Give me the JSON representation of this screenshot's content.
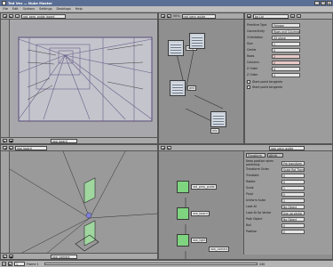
{
  "app": {
    "title": "Ted Vex — Nuke Master",
    "window_buttons": [
      "_",
      "□",
      "×"
    ]
  },
  "menubar": [
    "File",
    "Edit",
    "Options",
    "Settings",
    "Desktops",
    "Help"
  ],
  "pane_tl": {
    "field": "rod_perp_guide_board",
    "bottom_field": "row_board"
  },
  "pane_tr": {
    "zoom": "50%",
    "field": "rod_perp_guide",
    "nodes": [
      {
        "label": "rod_a"
      },
      {
        "label": "rod_b"
      },
      {
        "label": "grid"
      },
      {
        "label": "mix"
      }
    ]
  },
  "pane_tr_props": {
    "title_field": "ba Lid",
    "rows": [
      {
        "label": "Primitive Type",
        "value": "Polygon"
      },
      {
        "label": "Connectivity",
        "value": "Rows and Columns"
      },
      {
        "label": "Orientation",
        "value": "ZX plane"
      },
      {
        "label": "Size",
        "value": "1"
      },
      {
        "label": "Center",
        "value": "0"
      },
      {
        "label": "Rows",
        "value": "2"
      },
      {
        "label": "Columns",
        "value": "2"
      },
      {
        "label": "X Order",
        "value": "4"
      },
      {
        "label": "Z Order",
        "value": "4"
      }
    ],
    "checks": [
      "Start point tangents",
      "Start point tangents"
    ]
  },
  "pane_bl": {
    "field": "row_board",
    "bottom_field": "row_camera"
  },
  "pane_br": {
    "field": "row_perp_guide",
    "tab": "Transform",
    "tab2": "Attrib",
    "rows": [
      {
        "label": "Keep position when parenting",
        "value": "Pre transform"
      },
      {
        "label": "Transform Order",
        "value": "Scale Rot Trans"
      },
      {
        "label": "Translate",
        "value": "0"
      },
      {
        "label": "Rotate",
        "value": "0"
      },
      {
        "label": "Scale",
        "value": "1"
      },
      {
        "label": "Pivot",
        "value": "0"
      },
      {
        "label": "Uniform Scale",
        "value": "1"
      },
      {
        "label": "Look At",
        "value": "No Object"
      },
      {
        "label": "Look At Up Vector",
        "value": "Use up vector"
      },
      {
        "label": "Path Object",
        "value": "No Object"
      },
      {
        "label": "Roll",
        "value": "0"
      },
      {
        "label": "Position",
        "value": "0"
      }
    ],
    "nodes": [
      {
        "label": "rod_perp_guide"
      },
      {
        "label": "row_board"
      },
      {
        "label": "row_light"
      },
      {
        "label": "row_camera"
      }
    ]
  },
  "status": {
    "frame": "1",
    "label": "Frame 1",
    "end": "240"
  },
  "colors": {
    "titlebar": "#5a6f96",
    "pane": "#8f8f8f",
    "node_green": "#7fd47f"
  }
}
